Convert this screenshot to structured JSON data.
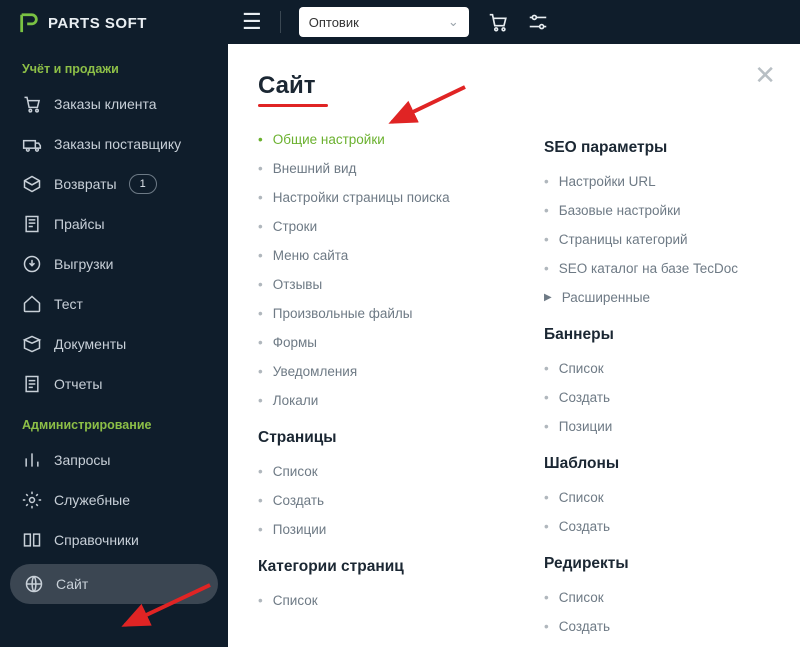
{
  "brand": {
    "mark": "P",
    "text": "PARTS SOFT"
  },
  "sidebar": {
    "section1_label": "Учёт и продажи",
    "section2_label": "Администрирование",
    "items1": [
      {
        "label": "Заказы клиента"
      },
      {
        "label": "Заказы поставщику"
      },
      {
        "label": "Возвраты",
        "badge": "1"
      },
      {
        "label": "Прайсы"
      },
      {
        "label": "Выгрузки"
      },
      {
        "label": "Тест"
      },
      {
        "label": "Документы"
      },
      {
        "label": "Отчеты"
      }
    ],
    "items2": [
      {
        "label": "Запросы"
      },
      {
        "label": "Служебные"
      },
      {
        "label": "Справочники"
      },
      {
        "label": "Сайт"
      }
    ]
  },
  "topbar": {
    "role_selected": "Оптовик"
  },
  "panel": {
    "title": "Сайт",
    "left": {
      "groups": [
        {
          "title": "",
          "items": [
            {
              "label": "Общие настройки",
              "sel": true
            },
            {
              "label": "Внешний вид"
            },
            {
              "label": "Настройки страницы поиска"
            },
            {
              "label": "Строки"
            },
            {
              "label": "Меню сайта"
            },
            {
              "label": "Отзывы"
            },
            {
              "label": "Произвольные файлы"
            },
            {
              "label": "Формы"
            },
            {
              "label": "Уведомления"
            },
            {
              "label": "Локали"
            }
          ]
        },
        {
          "title": "Страницы",
          "items": [
            {
              "label": "Список"
            },
            {
              "label": "Создать"
            },
            {
              "label": "Позиции"
            }
          ]
        },
        {
          "title": "Категории страниц",
          "items": [
            {
              "label": "Список"
            }
          ]
        }
      ]
    },
    "right": {
      "groups": [
        {
          "title": "SEO параметры",
          "items": [
            {
              "label": "Настройки URL"
            },
            {
              "label": "Базовые настройки"
            },
            {
              "label": "Страницы категорий"
            },
            {
              "label": "SEO каталог на базе TecDoc"
            },
            {
              "label": "Расширенные",
              "exp": true
            }
          ]
        },
        {
          "title": "Баннеры",
          "items": [
            {
              "label": "Список"
            },
            {
              "label": "Создать"
            },
            {
              "label": "Позиции"
            }
          ]
        },
        {
          "title": "Шаблоны",
          "items": [
            {
              "label": "Список"
            },
            {
              "label": "Создать"
            }
          ]
        },
        {
          "title": "Редиректы",
          "items": [
            {
              "label": "Список"
            },
            {
              "label": "Создать"
            }
          ]
        }
      ]
    }
  }
}
